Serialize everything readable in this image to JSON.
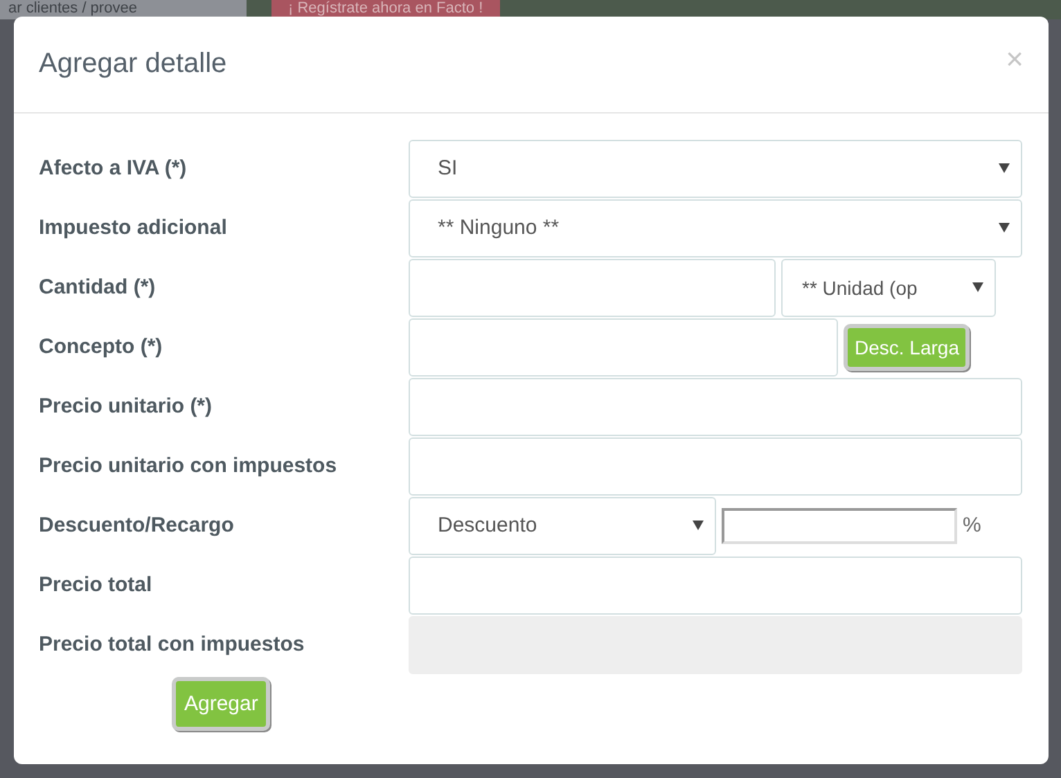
{
  "backdrop": {
    "search_placeholder": "ar clientes / provee",
    "banner": "¡ Regístrate ahora en Facto !"
  },
  "modal": {
    "title": "Agregar detalle",
    "close": "×"
  },
  "rows": [
    {
      "label": "Afecto a IVA (*)",
      "kind": "select",
      "value": "SI"
    },
    {
      "label": "Impuesto adicional",
      "kind": "select",
      "value": "** Ninguno **"
    },
    {
      "label": "Cantidad (*)",
      "kind": "input-select",
      "select_value": "** Unidad (op"
    },
    {
      "label": "Concepto (*)",
      "kind": "input-button",
      "button": "Desc. Larga"
    },
    {
      "label": "Precio unitario (*)",
      "kind": "input"
    },
    {
      "label": "Precio unitario con impuestos",
      "kind": "input"
    },
    {
      "label": "Descuento/Recargo",
      "kind": "select-input",
      "value": "Descuento",
      "suffix": "%"
    },
    {
      "label": "Precio total",
      "kind": "input"
    },
    {
      "label": "Precio total con impuestos",
      "kind": "readonly"
    }
  ],
  "submit": "Agregar"
}
